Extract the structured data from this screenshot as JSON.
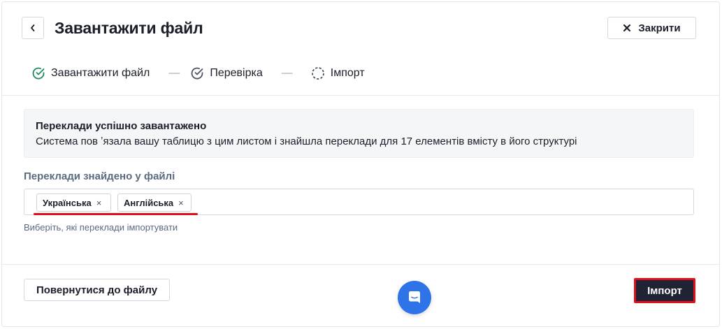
{
  "header": {
    "title": "Завантажити файл",
    "close_label": "Закрити"
  },
  "steps": [
    {
      "label": "Завантажити файл",
      "state": "done"
    },
    {
      "label": "Перевірка",
      "state": "done"
    },
    {
      "label": "Імпорт",
      "state": "pending"
    }
  ],
  "step_separator": "—",
  "alert": {
    "title": "Переклади успішно завантажено",
    "text": "Система пов ʼязала вашу таблицю з цим листом і знайшла переклади для 17 елементів вмісту в його структурі"
  },
  "translations": {
    "label": "Переклади знайдено у файлі",
    "tags": [
      "Українська",
      "Англійська"
    ],
    "remove_glyph": "×",
    "hint": "Виберіть, які переклади імпортувати"
  },
  "footer": {
    "back_label": "Повернутися до файлу",
    "import_label": "Імпорт"
  },
  "colors": {
    "accent_green": "#1e8a5e",
    "chat_blue": "#2f73e8",
    "primary_dark": "#1f2333",
    "highlight_red": "#e0101c"
  },
  "icons": {
    "back": "chevron-left-icon",
    "close": "x-icon",
    "step_done_green": "check-circle-icon",
    "step_done_gray": "check-circle-icon",
    "step_pending": "dashed-circle-icon",
    "chat": "chat-bubble-icon"
  }
}
